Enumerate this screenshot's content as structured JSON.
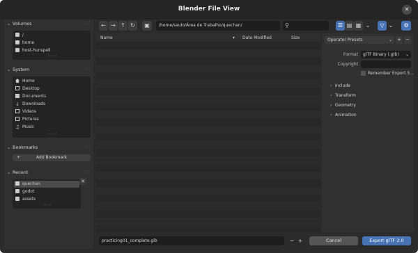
{
  "window": {
    "title": "Blender File View",
    "close_glyph": "✕"
  },
  "sidebar": {
    "volumes": {
      "title": "Volumes",
      "items": [
        "/",
        "home",
        "host-hunspell"
      ]
    },
    "system": {
      "title": "System",
      "items": [
        "Home",
        "Desktop",
        "Documents",
        "Downloads",
        "Videos",
        "Pictures",
        "Music"
      ]
    },
    "bookmarks": {
      "title": "Bookmarks",
      "add_label": "Add Bookmark"
    },
    "recent": {
      "title": "Recent",
      "items": [
        "quechan",
        "godot",
        "assets"
      ],
      "selected": "quechan"
    }
  },
  "toolbar": {
    "path": "/home/saulo/Área de Trabalho/quechan/",
    "search_placeholder": ""
  },
  "filelist": {
    "columns": {
      "name": "Name",
      "date": "Date Modified",
      "size": "Size"
    }
  },
  "options": {
    "operator_presets": "Operator Presets",
    "format_label": "Format",
    "format_value": "glTF Binary (.glb)",
    "copyright_label": "Copyright",
    "copyright_value": "",
    "remember_label": "Remember Export S...",
    "sections": [
      "Include",
      "Transform",
      "Geometry",
      "Animation"
    ]
  },
  "bottom": {
    "filename": "practicing01_complete.glb",
    "cancel_label": "Cancel",
    "export_label": "Export glTF 2.0"
  },
  "colors": {
    "accent": "#4772b3"
  }
}
